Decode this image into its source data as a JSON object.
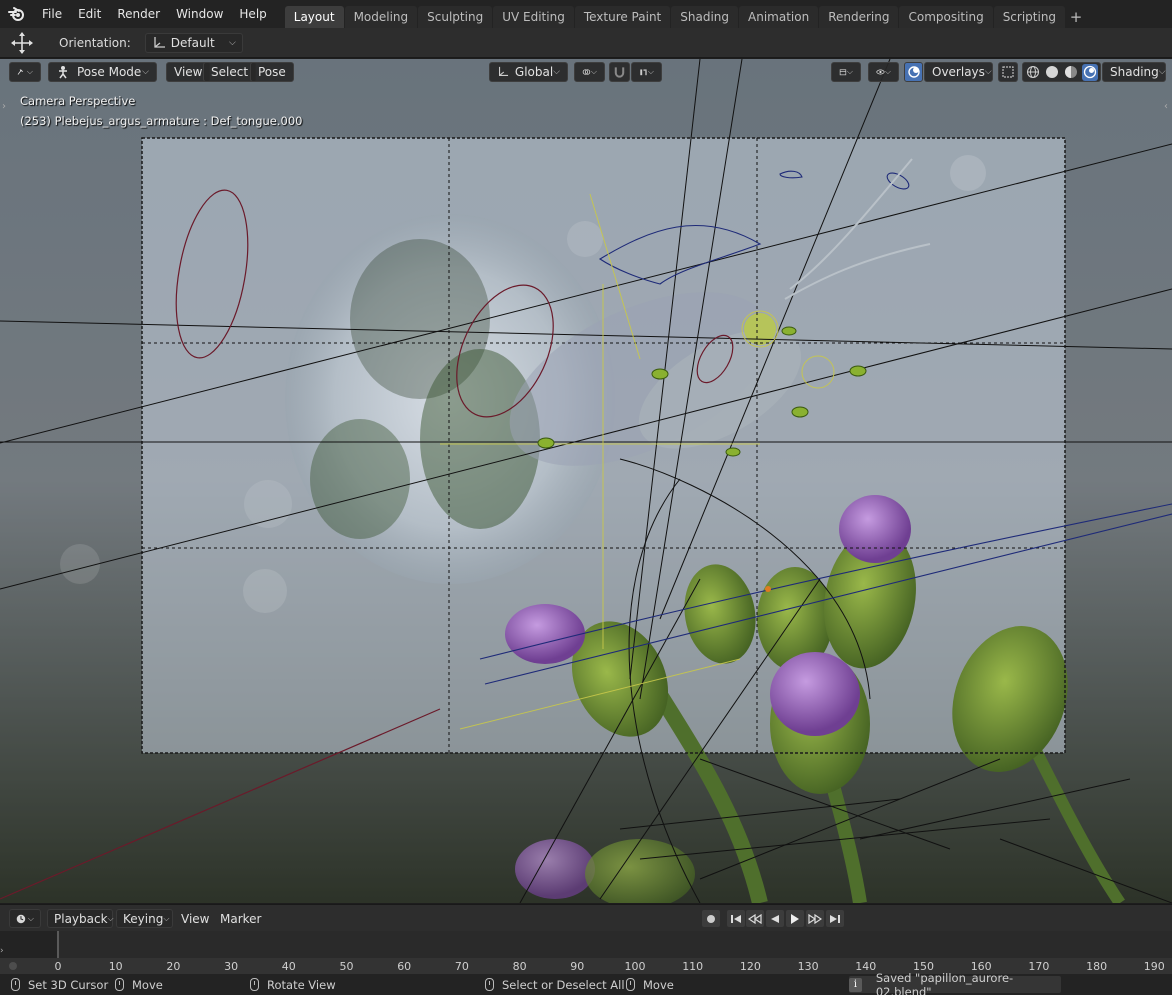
{
  "app": {
    "name": "Blender",
    "logo_icon": "blender-logo-icon"
  },
  "menu": [
    "File",
    "Edit",
    "Render",
    "Window",
    "Help"
  ],
  "workspace_tabs": [
    {
      "label": "Layout",
      "active": true
    },
    {
      "label": "Modeling",
      "active": false
    },
    {
      "label": "Sculpting",
      "active": false
    },
    {
      "label": "UV Editing",
      "active": false
    },
    {
      "label": "Texture Paint",
      "active": false
    },
    {
      "label": "Shading",
      "active": false
    },
    {
      "label": "Animation",
      "active": false
    },
    {
      "label": "Rendering",
      "active": false
    },
    {
      "label": "Compositing",
      "active": false
    },
    {
      "label": "Scripting",
      "active": false
    }
  ],
  "add_workspace_label": "+",
  "tool_header": {
    "active_tool_icon": "move-transform-icon",
    "orientation_label": "Orientation:",
    "orientation_value": "Default"
  },
  "viewport_header": {
    "editor_type_icon": "armature-editor-icon",
    "mode": "Pose Mode",
    "menus": [
      "View",
      "Select",
      "Pose"
    ],
    "transform_orientation": "Global",
    "pivot_icon": "pivot-point-icon",
    "snap_icon": "snap-magnet-icon",
    "proportional_icon": "proportional-edit-icon",
    "visibility_icon": "object-type-visibility-icon",
    "gizmo_icon": "gizmo-eye-icon",
    "overlays_label": "Overlays",
    "xray_icon": "xray-icon",
    "shading_label": "Shading",
    "shading_modes": [
      "wireframe-shading-icon",
      "solid-shading-icon",
      "material-preview-icon",
      "rendered-shading-icon"
    ]
  },
  "viewport_info": {
    "view_name": "Camera Perspective",
    "active_object": "(253) Plebejus_argus_armature : Def_tongue.000"
  },
  "timeline_header": {
    "editor_icon": "clock-icon",
    "menus": [
      "Playback",
      "Keying",
      "View",
      "Marker"
    ],
    "playback_icons": [
      "record-icon",
      "jump-start-icon",
      "prev-keyframe-icon",
      "play-reverse-icon",
      "play-icon",
      "next-keyframe-icon",
      "jump-end-icon"
    ]
  },
  "timeline": {
    "current_frame_marker": 0,
    "frame_ticks": [
      "0",
      "10",
      "20",
      "30",
      "40",
      "50",
      "60",
      "70",
      "80",
      "90",
      "100",
      "110",
      "120",
      "130",
      "140",
      "150",
      "160",
      "170",
      "180",
      "190"
    ]
  },
  "status_bar": {
    "items": [
      {
        "icon": "mouse-left-icon",
        "label": "Set 3D Cursor"
      },
      {
        "icon": "mouse-drag-icon",
        "label": "Move"
      },
      {
        "icon": "mouse-middle-icon",
        "label": "Rotate View"
      },
      {
        "icon": "mouse-left-icon",
        "label": "Select or Deselect All"
      },
      {
        "icon": "mouse-drag-icon",
        "label": "Move"
      }
    ],
    "info_icon": "info-icon",
    "message": "Saved \"papillon_aurore-02.blend\""
  }
}
